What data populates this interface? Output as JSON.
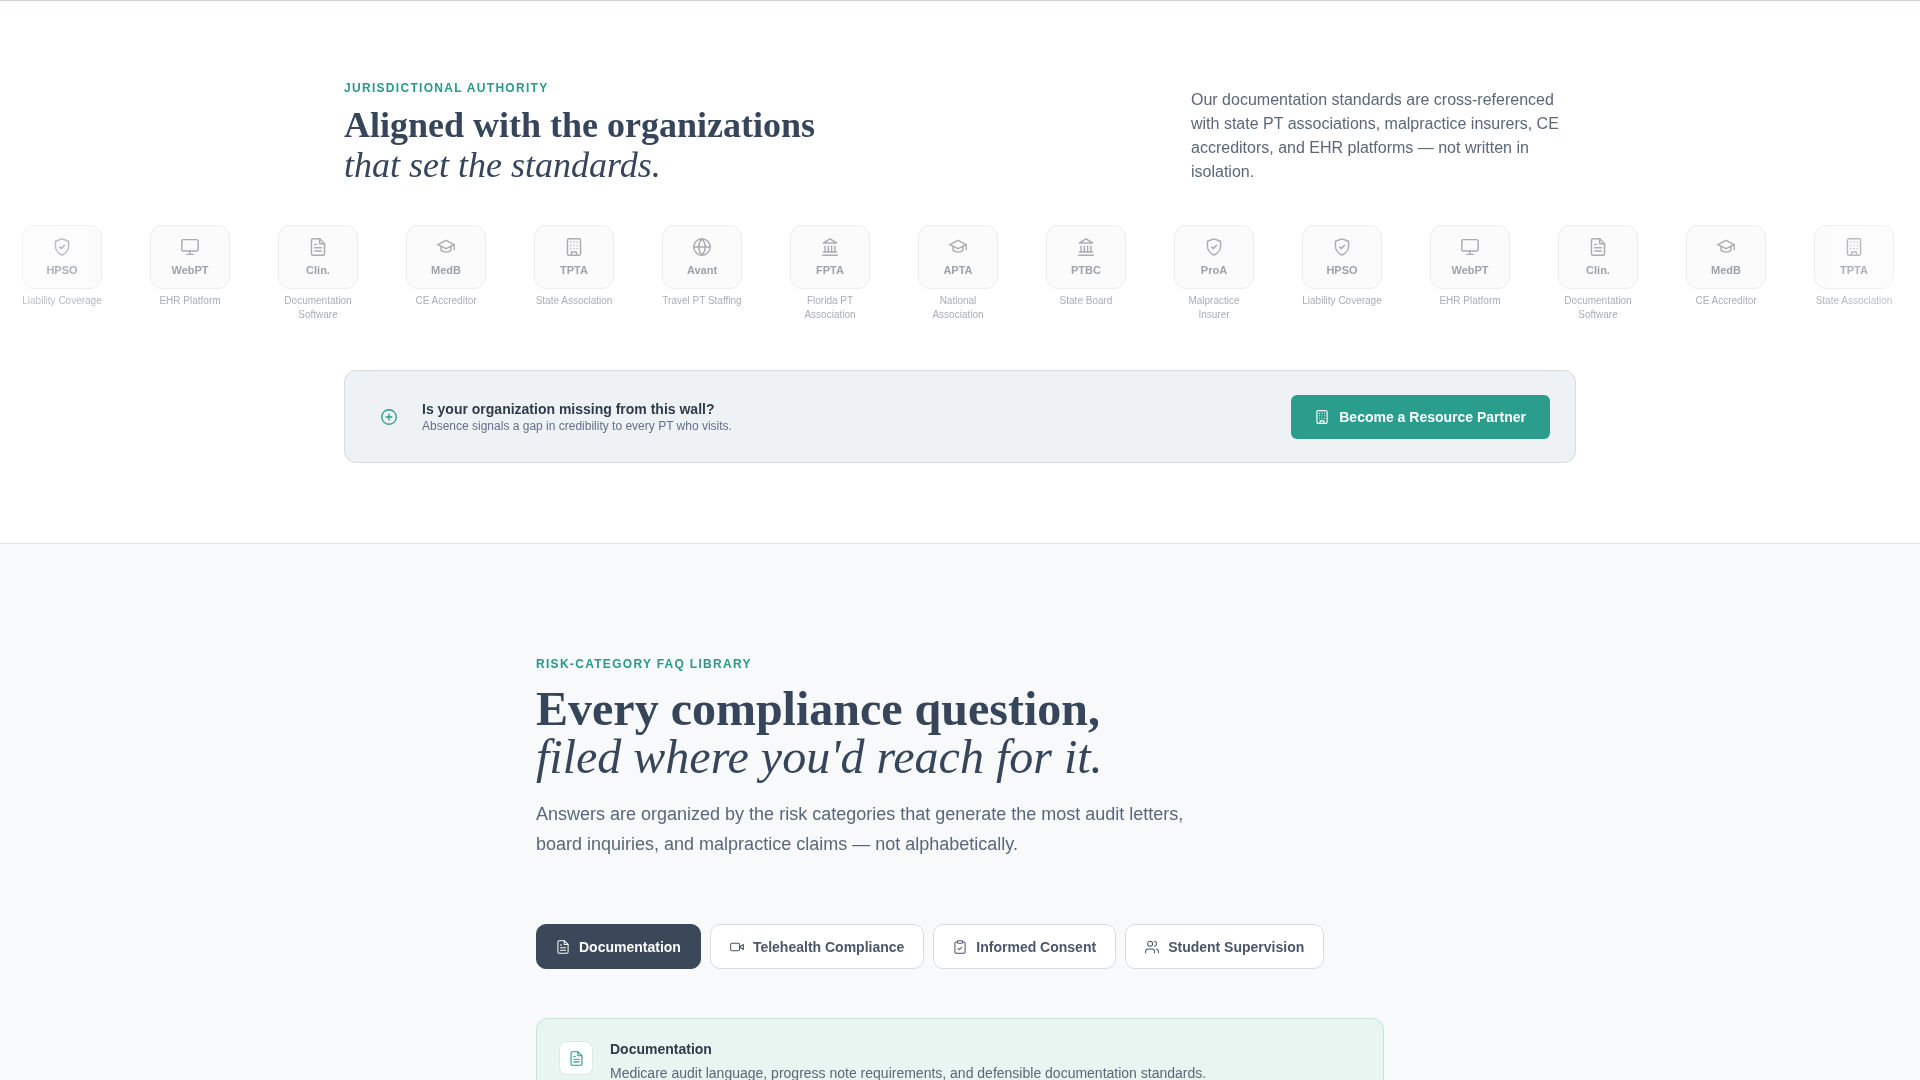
{
  "authority": {
    "eyebrow": "JURISDICTIONAL AUTHORITY",
    "heading": "Aligned with the organizations",
    "heading_italic": "that set the standards.",
    "description": "Our documentation standards are cross-referenced with state PT associations, malpractice insurers, CE accreditors, and EHR platforms — not written in isolation."
  },
  "partner_logos": [
    {
      "abbr": "HPSO",
      "label": "Liability Coverage",
      "kind": "shield"
    },
    {
      "abbr": "WebPT",
      "label": "EHR Platform",
      "kind": "monitor"
    },
    {
      "abbr": "Clin.",
      "label": "Documentation Software",
      "kind": "document"
    },
    {
      "abbr": "MedB",
      "label": "CE Accreditor",
      "kind": "cap"
    },
    {
      "abbr": "TPTA",
      "label": "State Association",
      "kind": "building"
    },
    {
      "abbr": "Avant",
      "label": "Travel PT Staffing",
      "kind": "globe"
    },
    {
      "abbr": "FPTA",
      "label": "Florida PT Association",
      "kind": "bank"
    },
    {
      "abbr": "APTA",
      "label": "National Association",
      "kind": "cap"
    },
    {
      "abbr": "PTBC",
      "label": "State Board",
      "kind": "bank"
    },
    {
      "abbr": "ProA",
      "label": "Malpractice Insurer",
      "kind": "shield"
    },
    {
      "abbr": "HPSO",
      "label": "Liability Coverage",
      "kind": "shield"
    },
    {
      "abbr": "WebPT",
      "label": "EHR Platform",
      "kind": "monitor"
    },
    {
      "abbr": "Clin.",
      "label": "Documentation Software",
      "kind": "document"
    },
    {
      "abbr": "MedB",
      "label": "CE Accreditor",
      "kind": "cap"
    },
    {
      "abbr": "TPTA",
      "label": "State Association",
      "kind": "building"
    }
  ],
  "partner_banner": {
    "title": "Is your organization missing from this wall?",
    "subtitle": "Absence signals a gap in credibility to every PT who visits.",
    "button": "Become a Resource Partner"
  },
  "faq": {
    "eyebrow": "RISK-CATEGORY FAQ LIBRARY",
    "heading": "Every compliance question,",
    "heading_italic": "filed where you'd reach for it.",
    "description": "Answers are organized by the risk categories that generate the most audit letters, board inquiries, and malpractice claims — not alphabetically.",
    "tabs": [
      {
        "label": "Documentation",
        "kind": "document",
        "selected": true
      },
      {
        "label": "Telehealth Compliance",
        "kind": "video",
        "selected": false
      },
      {
        "label": "Informed Consent",
        "kind": "clipboard",
        "selected": false
      },
      {
        "label": "Student Supervision",
        "kind": "people",
        "selected": false
      }
    ],
    "category_card": {
      "title": "Documentation",
      "description": "Medicare audit language, progress note requirements, and defensible documentation standards."
    }
  }
}
